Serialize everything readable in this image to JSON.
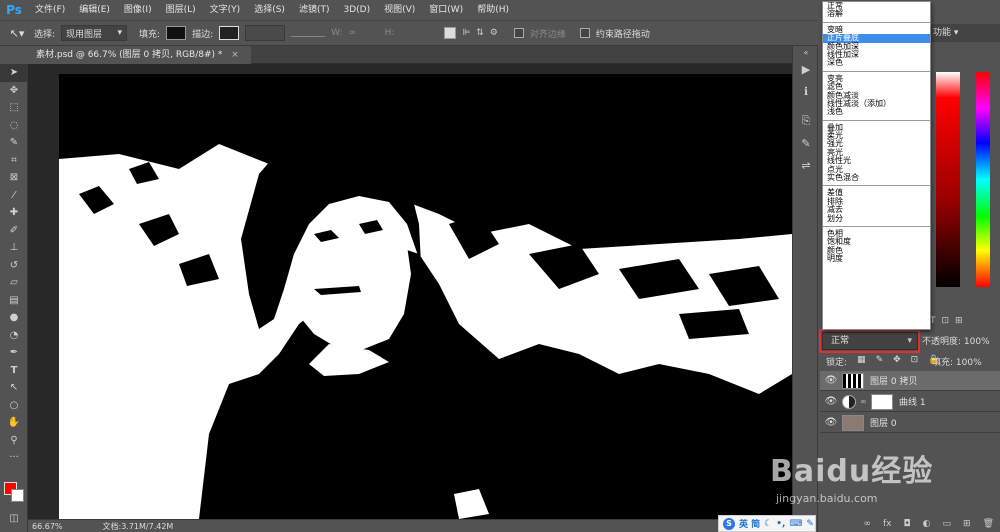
{
  "menubar": {
    "logo": "Ps",
    "items": [
      "文件(F)",
      "编辑(E)",
      "图像(I)",
      "图层(L)",
      "文字(Y)",
      "选择(S)",
      "滤镜(T)",
      "3D(D)",
      "视图(V)",
      "窗口(W)",
      "帮助(H)"
    ]
  },
  "optionsbar": {
    "select_label": "选择:",
    "select_value": "现用图层",
    "fill_label": "填充:",
    "stroke_label": "描边:",
    "w_label": "W:",
    "h_label": "H:",
    "align_edges": "对齐边缘",
    "constrain": "约束路径拖动"
  },
  "doc": {
    "tab_title": "素材.psd @ 66.7% (图层 0 拷贝, RGB/8#) *",
    "close": "×"
  },
  "status": {
    "zoom": "66.67%",
    "docinfo": "文档:3.71M/7.42M"
  },
  "workspace": {
    "label": "功能"
  },
  "blend_menu": {
    "groups": [
      [
        "正常",
        "溶解"
      ],
      [
        "变暗",
        "正片叠底",
        "颜色加深",
        "线性加深",
        "深色"
      ],
      [
        "变亮",
        "滤色",
        "颜色减淡",
        "线性减淡（添加）",
        "浅色"
      ],
      [
        "叠加",
        "柔光",
        "强光",
        "亮光",
        "线性光",
        "点光",
        "实色混合"
      ],
      [
        "差值",
        "排除",
        "减去",
        "划分"
      ],
      [
        "色相",
        "饱和度",
        "颜色",
        "明度"
      ]
    ],
    "highlighted": "正片叠底"
  },
  "layers_panel": {
    "blend_value": "正常",
    "opacity_label": "不透明度:",
    "opacity_value": "100%",
    "lock_label": "锁定:",
    "fill_label": "填充:",
    "fill_value": "100%",
    "layers": [
      {
        "name": "图层 0 拷贝",
        "selected": true
      },
      {
        "name": "曲线 1",
        "selected": false
      },
      {
        "name": "图层 0",
        "selected": false
      }
    ]
  },
  "ime": {
    "label": "英 简"
  },
  "watermark": {
    "main": "Baidu经验",
    "sub": "jingyan.baidu.com"
  },
  "colors": {
    "foreground": "#ff0000",
    "background": "#ffffff",
    "highlight": "#3c8ee8",
    "outline": "#e3302f"
  }
}
